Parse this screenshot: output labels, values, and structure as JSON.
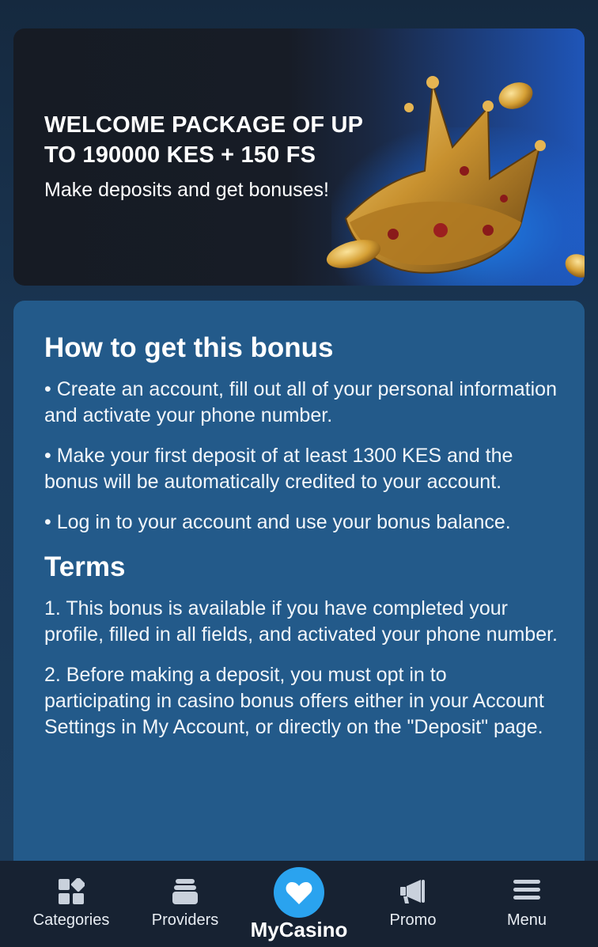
{
  "banner": {
    "title": "WELCOME PACKAGE OF UP TO 190000 KES + 150 FS",
    "subtitle": "Make deposits and get bonuses!"
  },
  "how_to": {
    "heading": "How to get this bonus",
    "items": [
      "• Create an account, fill out all of your personal information and activate your phone number.",
      "• Make your first deposit of at least 1300 KES and the bonus will be automatically credited to your account.",
      "• Log in to your account and use your bonus balance."
    ]
  },
  "terms": {
    "heading": "Terms",
    "items": [
      "1. This bonus is available if you have completed your profile, filled in all fields, and activated your phone number.",
      "2. Before making a deposit, you must opt in to participating in casino bonus offers either in your Account Settings in My Account, or directly on the \"Deposit\" page."
    ]
  },
  "nav": {
    "items": [
      {
        "label": "Categories",
        "icon": "categories-icon"
      },
      {
        "label": "Providers",
        "icon": "providers-icon"
      },
      {
        "label": "MyCasino",
        "icon": "heart-icon"
      },
      {
        "label": "Promo",
        "icon": "megaphone-icon"
      },
      {
        "label": "Menu",
        "icon": "hamburger-menu-icon"
      }
    ]
  },
  "colors": {
    "background": "#1b3a5a",
    "card": "#235a8a",
    "nav": "#172232",
    "accent": "#2aa3ef"
  }
}
